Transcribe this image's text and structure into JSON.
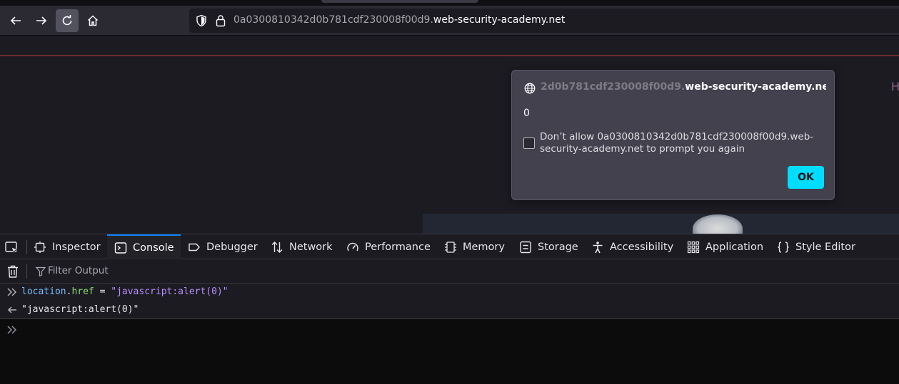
{
  "browser": {
    "url_prefix": "0a0300810342d0b781cdf230008f00d9.",
    "url_domain": "web-security-academy.net",
    "icons": [
      "back-arrow-icon",
      "forward-arrow-icon",
      "reload-icon",
      "home-icon",
      "shield-icon",
      "lock-icon"
    ]
  },
  "page": {
    "edge_letter": "H"
  },
  "dialog": {
    "origin_faded": "2d0b781cdf230008f00d9.",
    "origin_main": "web-security-academy.net",
    "message": "0",
    "checkbox_label": "Don’t allow 0a0300810342d0b781cdf230008f00d9.web-security-academy.net to prompt you again",
    "checkbox_checked": false,
    "ok_label": "OK",
    "accent": "#00ddff"
  },
  "devtools": {
    "tabs": [
      {
        "label": "Inspector",
        "icon": "inspector-icon"
      },
      {
        "label": "Console",
        "icon": "console-icon",
        "active": true
      },
      {
        "label": "Debugger",
        "icon": "debugger-icon"
      },
      {
        "label": "Network",
        "icon": "network-icon"
      },
      {
        "label": "Performance",
        "icon": "performance-icon"
      },
      {
        "label": "Memory",
        "icon": "memory-icon"
      },
      {
        "label": "Storage",
        "icon": "storage-icon"
      },
      {
        "label": "Accessibility",
        "icon": "accessibility-icon"
      },
      {
        "label": "Application",
        "icon": "application-icon"
      },
      {
        "label": "Style Editor",
        "icon": "style-editor-icon"
      }
    ],
    "filter_placeholder": "Filter Output",
    "console": {
      "input_var": "location",
      "input_dot": ".",
      "input_prop": "href",
      "input_eq": " = ",
      "input_str": "\"javascript:alert(0)\"",
      "output": "\"javascript:alert(0)\""
    },
    "accent": "#0a84ff"
  }
}
